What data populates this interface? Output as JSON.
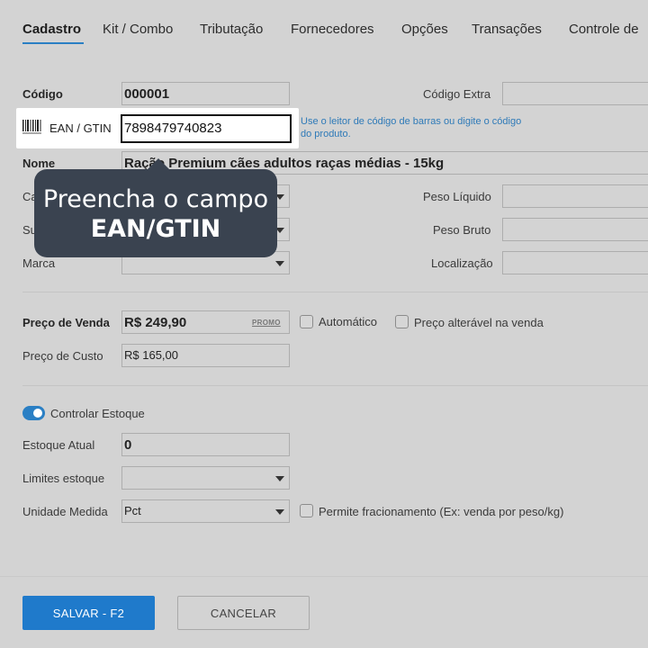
{
  "tabs": [
    "Cadastro",
    "Kit / Combo",
    "Tributação",
    "Fornecedores",
    "Opções",
    "Transações",
    "Controle de"
  ],
  "form": {
    "codigo_label": "Código",
    "codigo_value": "000001",
    "codigo_extra_label": "Código Extra",
    "ean_label": "EAN / GTIN",
    "ean_value": "7898479740823",
    "ean_hint": "Use o leitor de código de barras ou digite o código do produto.",
    "nome_label": "Nome",
    "nome_value": "Ração Premium cães adultos raças médias - 15kg",
    "categoria_label_partial": "Ca",
    "subcategoria_label_partial": "Su",
    "marca_label": "Marca",
    "peso_liquido_label": "Peso Líquido",
    "peso_bruto_label": "Peso Bruto",
    "localizacao_label": "Localização",
    "preco_venda_label": "Preço de Venda",
    "preco_venda_value": "R$ 249,90",
    "promo_label": "PROMO",
    "automatico_label": "Automático",
    "preco_alteravel_label": "Preço alterável na venda",
    "preco_custo_label": "Preço de Custo",
    "preco_custo_value": "R$ 165,00",
    "controlar_estoque_label": "Controlar Estoque",
    "estoque_atual_label": "Estoque Atual",
    "estoque_atual_value": "0",
    "limites_estoque_label": "Limites estoque",
    "unidade_medida_label": "Unidade Medida",
    "unidade_medida_value": "Pct",
    "fracionamento_label": "Permite fracionamento (Ex: venda por peso/kg)"
  },
  "tooltip": {
    "line1": "Preencha o campo",
    "line2": "EAN/GTIN"
  },
  "buttons": {
    "save": "SALVAR - F2",
    "cancel": "CANCELAR"
  },
  "colors": {
    "accent": "#1f7acb",
    "tooltip_bg": "#3a4350",
    "hint_text": "#2e7ab8"
  }
}
